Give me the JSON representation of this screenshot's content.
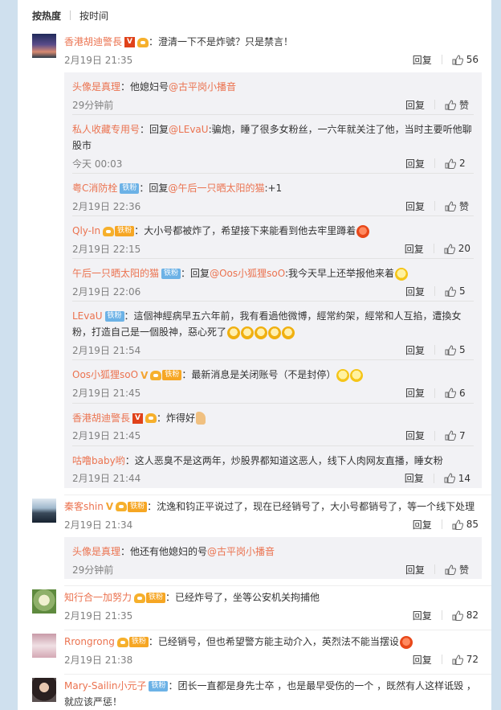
{
  "sort": {
    "hot": "按热度",
    "time": "按时间"
  },
  "labels": {
    "reply": "回复",
    "like": "赞"
  },
  "comments": [
    {
      "user": "香港胡迪警長",
      "sep": "：",
      "text": "澄清一下不是炸號？只是禁言！",
      "time": "2月19日 21:35",
      "likes": "56",
      "replies": [
        {
          "user": "头像是真理",
          "sep": "：",
          "pre": "他媳妇号",
          "mention": "@古平岗小播音",
          "post": "",
          "time": "29分钟前",
          "likes": "赞"
        },
        {
          "user": "私人收藏专用号",
          "sep": "：",
          "pre": "回复",
          "mention": "@LEvaU",
          "post": ":骗炮，睡了很多女粉丝，一六年就关注了他，当时主要听他聊股市",
          "time": "今天 00:03",
          "likes": "2"
        },
        {
          "user": "粤C消防栓",
          "badge": "铁粉",
          "sep": "：",
          "pre": "回复",
          "mention": "@午后一只晒太阳的猫",
          "post": ":+1",
          "time": "2月19日 22:36",
          "likes": "赞"
        },
        {
          "user": "Qly-In",
          "badge": "铁粉",
          "sep": "：",
          "pre": "大小号都被炸了，希望接下来能看到他去牢里蹲着",
          "mention": "",
          "post": "",
          "time": "2月19日 22:15",
          "likes": "20"
        },
        {
          "user": "午后一只晒太阳的猫",
          "badge": "铁粉",
          "sep": "：",
          "pre": "回复",
          "mention": "@Oos小狐狸soO",
          "post": ":我今天早上还举报他来着",
          "time": "2月19日 22:06",
          "likes": "5"
        },
        {
          "user": "LEvaU",
          "badge": "铁粉",
          "sep": "：",
          "pre": "這個神經病早五六年前，我有看過他微博，經常約架，經常和人互掐，遭換女粉，打造自己是一個股神，惡心死了",
          "mention": "",
          "post": "",
          "time": "2月19日 21:54",
          "likes": "5"
        },
        {
          "user": "Oos小狐狸soO",
          "badge": "铁粉",
          "sep": "：",
          "pre": "最新消息是关闭账号（不是封停）",
          "mention": "",
          "post": "",
          "time": "2月19日 21:45",
          "likes": "6"
        },
        {
          "user": "香港胡迪警長",
          "sep": "：",
          "pre": "炸得好",
          "mention": "",
          "post": "",
          "time": "2月19日 21:45",
          "likes": "7"
        },
        {
          "user": "咕噜baby哟",
          "sep": "：",
          "pre": "这人恶臭不是这两年，炒股界都知道这恶人，线下人肉网友直播，睡女粉",
          "mention": "",
          "post": "",
          "time": "2月19日 21:44",
          "likes": "14"
        }
      ]
    },
    {
      "user": "秦客shin",
      "badge": "铁粉",
      "sep": "：",
      "text": "沈逸和钧正平说过了，现在已经销号了，大小号都销号了，等一个线下处理",
      "time": "2月19日 21:34",
      "likes": "85",
      "replies": [
        {
          "user": "头像是真理",
          "sep": "：",
          "pre": "他还有他媳妇的号",
          "mention": "@古平岗小播音",
          "post": "",
          "time": "29分钟前",
          "likes": "赞"
        }
      ]
    },
    {
      "user": "知行合一加努力",
      "badge": "铁粉",
      "sep": "：",
      "text": "已经炸号了，坐等公安机关拘捕他",
      "time": "2月19日 21:35",
      "likes": "82"
    },
    {
      "user": "Rrongrong",
      "badge": "铁粉",
      "sep": "：",
      "text": "已经销号，但也希望警方能主动介入，英烈法不能当摆设",
      "time": "2月19日 21:38",
      "likes": "72"
    },
    {
      "user": "Mary-Sailin小元子",
      "badge": "铁粉",
      "sep": "：",
      "text": "团长一直都是身先士卒 ，也是最早受伤的一个 ，既然有人这样诋毁 ，就应该严惩！",
      "time": "",
      "likes": ""
    }
  ]
}
